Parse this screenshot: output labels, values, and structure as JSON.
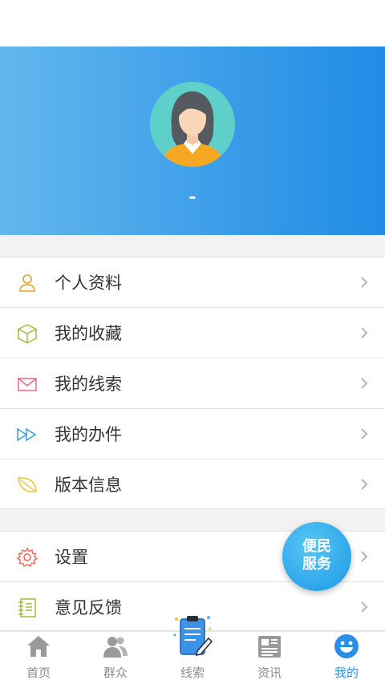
{
  "profile": {
    "name": "-"
  },
  "menu_group_1": [
    {
      "label": "个人资料",
      "icon": "person-outline-icon"
    },
    {
      "label": "我的收藏",
      "icon": "cube-icon"
    },
    {
      "label": "我的线索",
      "icon": "envelope-icon"
    },
    {
      "label": "我的办件",
      "icon": "fast-forward-icon"
    },
    {
      "label": "版本信息",
      "icon": "leaf-icon"
    }
  ],
  "menu_group_2": [
    {
      "label": "设置",
      "icon": "gear-icon"
    },
    {
      "label": "意见反馈",
      "icon": "notebook-icon"
    }
  ],
  "fab": {
    "line1": "便民",
    "line2": "服务"
  },
  "tabs": [
    {
      "label": "首页",
      "icon": "home-icon"
    },
    {
      "label": "群众",
      "icon": "people-icon"
    },
    {
      "label": "线索",
      "icon": "clipboard-edit-icon"
    },
    {
      "label": "资讯",
      "icon": "newspaper-icon"
    },
    {
      "label": "我的",
      "icon": "smiley-icon",
      "active": true
    }
  ],
  "colors": {
    "accent": "#2a8fe6",
    "header_start": "#63b7ec",
    "header_end": "#1f8ce6",
    "inactive_tab": "#8c8c8c"
  }
}
